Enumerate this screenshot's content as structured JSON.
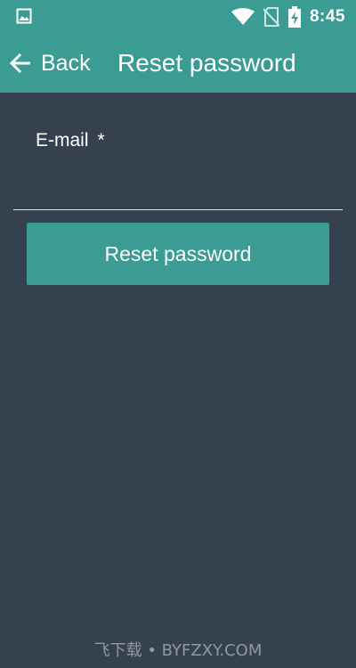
{
  "status_bar": {
    "time": "8:45",
    "icons": [
      "image-notification-icon",
      "wifi-icon",
      "no-sim-icon",
      "battery-charging-icon"
    ]
  },
  "app_bar": {
    "back_label": "Back",
    "title": "Reset password"
  },
  "form": {
    "email_label": "E-mail",
    "required_marker": "*",
    "email_value": ""
  },
  "reset_button_label": "Reset password",
  "watermark": "飞下载 • BYFZXY.COM",
  "colors": {
    "accent": "#3a9c92",
    "background": "#364150",
    "text": "#ffffff"
  }
}
